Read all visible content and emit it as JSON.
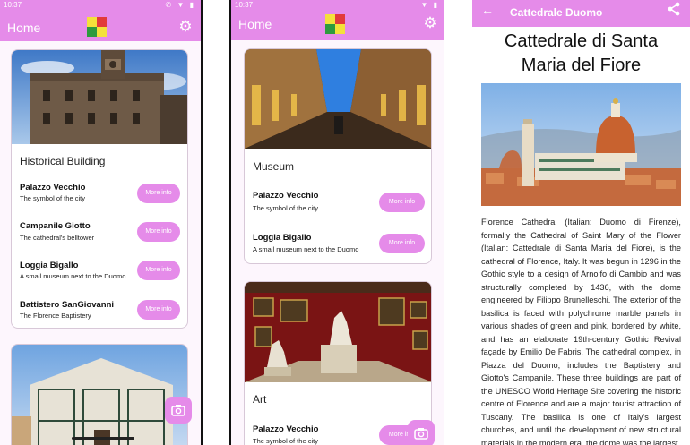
{
  "screen1": {
    "status_time": "10:37",
    "status_icons": "✆ ▼ ▮",
    "title": "Home",
    "card1": {
      "category": "Historical Building",
      "items": [
        {
          "title": "Palazzo Vecchio",
          "subtitle": "The symbol of the city",
          "button": "More info"
        },
        {
          "title": "Campanile Giotto",
          "subtitle": "The cathedral's belltower",
          "button": "More info"
        },
        {
          "title": "Loggia Bigallo",
          "subtitle": "A small museum next to the Duomo",
          "button": "More info"
        },
        {
          "title": "Battistero SanGiovanni",
          "subtitle": "The Florence Baptistery",
          "button": "More info"
        }
      ]
    },
    "fab_icon": "camera-icon"
  },
  "screen2": {
    "status_time": "10:37",
    "status_icons": "▼ ▮",
    "title": "Home",
    "card1": {
      "category": "Museum",
      "items": [
        {
          "title": "Palazzo Vecchio",
          "subtitle": "The symbol of the city",
          "button": "More info"
        },
        {
          "title": "Loggia Bigallo",
          "subtitle": "A small museum next to the Duomo",
          "button": "More info"
        }
      ]
    },
    "card2": {
      "category": "Art",
      "items": [
        {
          "title": "Palazzo Vecchio",
          "subtitle": "The symbol of the city",
          "button": "More info"
        }
      ]
    }
  },
  "screen3": {
    "appbar_title": "Cattedrale Duomo",
    "title": "Cattedrale di Santa Maria del Fiore",
    "body": "Florence Cathedral (Italian: Duomo di Firenze), formally the Cathedral of Saint Mary of the Flower (Italian: Cattedrale di Santa Maria del Fiore), is the cathedral of Florence, Italy. It was begun in 1296 in the Gothic style to a design of Arnolfo di Cambio and was structurally completed by 1436, with the dome engineered by Filippo Brunelleschi. The exterior of the basilica is faced with polychrome marble panels in various shades of green and pink, bordered by white, and has an elaborate 19th-century Gothic Revival façade by Emilio De Fabris. The cathedral complex, in Piazza del Duomo, includes the Baptistery and Giotto's Campanile. These three buildings are part of the UNESCO World Heritage Site covering the historic centre of Florence and are a major tourist attraction of Tuscany. The basilica is one of Italy's largest churches, and until the development of new structural materials in the modern era, the dome was the largest"
  },
  "colors": {
    "accent": "#e58be9",
    "card_background": "#ffffff",
    "screen_background": "#fdf6fd"
  }
}
